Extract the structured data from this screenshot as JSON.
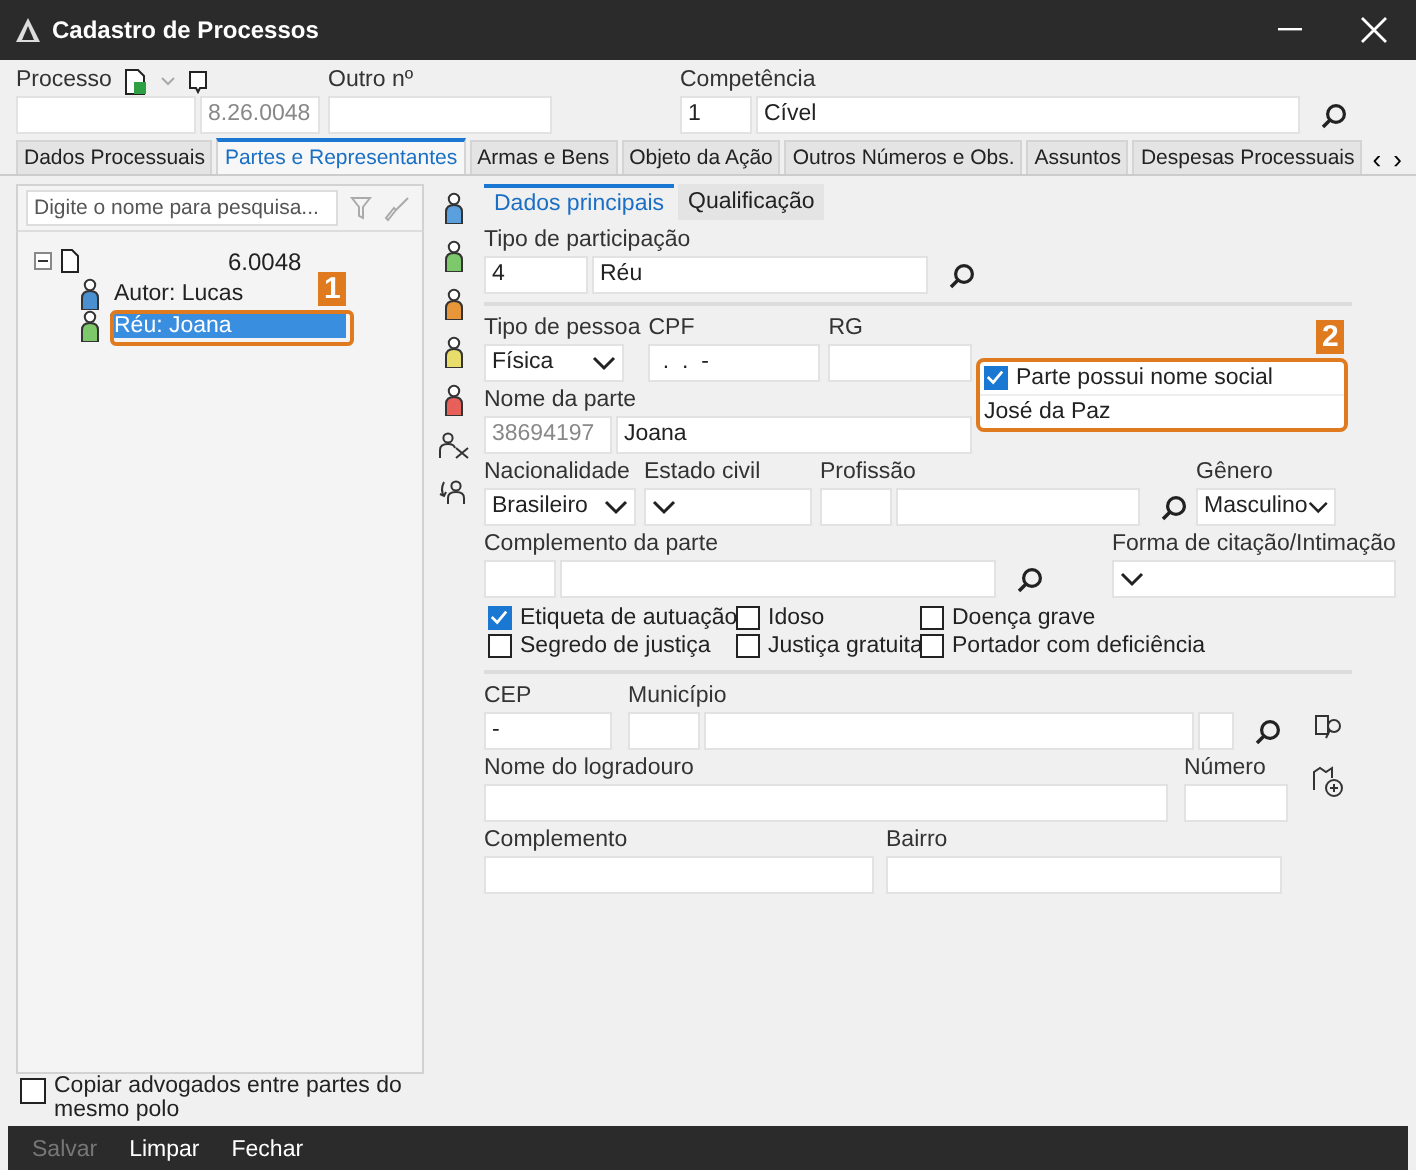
{
  "window": {
    "title": "Cadastro de Processos"
  },
  "header": {
    "processo_label": "Processo",
    "processo_suffix": "8.26.0048",
    "outro_label": "Outro nº",
    "competencia_label": "Competência",
    "competencia_code": "1",
    "competencia_name": "Cível"
  },
  "tabs": [
    {
      "label": "Dados Processuais",
      "selected": false
    },
    {
      "label": "Partes e Representantes",
      "selected": true
    },
    {
      "label": "Armas e Bens",
      "selected": false
    },
    {
      "label": "Objeto da Ação",
      "selected": false
    },
    {
      "label": "Outros Números e Obs.",
      "selected": false
    },
    {
      "label": "Assuntos",
      "selected": false
    },
    {
      "label": "Despesas Processuais",
      "selected": false
    }
  ],
  "tab_scroll": [
    "‹",
    "›"
  ],
  "search": {
    "placeholder": "Digite o nome para pesquisa..."
  },
  "tree": {
    "label": "6.0048",
    "expanded": true,
    "children": [
      {
        "label": "Autor: Lucas",
        "selected": false,
        "color": "#4a8fd0"
      },
      {
        "label": "Réu: Joana",
        "selected": true,
        "color": "#7cc86a"
      }
    ]
  },
  "callouts": [
    "1",
    "2"
  ],
  "party_tools": [
    {
      "color": "#5aa0de"
    },
    {
      "color": "#7cc86a"
    },
    {
      "color": "#e8963a"
    },
    {
      "color": "#e8dc6a"
    },
    {
      "color": "#e8605a"
    }
  ],
  "subtabs": [
    {
      "label": "Dados principais",
      "selected": true
    },
    {
      "label": "Qualificação",
      "selected": false
    }
  ],
  "form_rows": [
    [
      {
        "label": "Tipo de participação",
        "search": true,
        "inputs": [
          {
            "kind": "text",
            "value": "4"
          },
          {
            "kind": "text",
            "value": "Réu"
          }
        ]
      }
    ],
    [
      {
        "label": "Tipo de pessoa",
        "search": false,
        "inputs": [
          {
            "kind": "select",
            "value": "Física"
          }
        ]
      },
      {
        "label": "CPF",
        "search": false,
        "inputs": [
          {
            "kind": "text",
            "value": " .  .  -"
          }
        ]
      },
      {
        "label": "RG",
        "search": false,
        "inputs": [
          {
            "kind": "text"
          }
        ]
      }
    ],
    [
      {
        "label": "Nome da parte",
        "search": false,
        "inputs": [
          {
            "kind": "readonly",
            "value": "38694197"
          },
          {
            "kind": "text",
            "value": "Joana"
          }
        ]
      }
    ],
    [
      {
        "label": "Nacionalidade",
        "search": false,
        "inputs": [
          {
            "kind": "select",
            "value": "Brasileiro"
          }
        ]
      },
      {
        "label": "Estado civil",
        "search": false,
        "inputs": [
          {
            "kind": "select"
          }
        ]
      },
      {
        "label": "Profissão",
        "search": true,
        "inputs": [
          {
            "kind": "text"
          },
          {
            "kind": "text"
          }
        ]
      },
      {
        "label": "Gênero",
        "search": false,
        "inputs": [
          {
            "kind": "select",
            "value": "Masculino"
          }
        ]
      }
    ],
    [
      {
        "label": "Complemento da parte",
        "search": true,
        "inputs": [
          {
            "kind": "text"
          },
          {
            "kind": "text"
          }
        ]
      },
      {
        "label": "Forma de citação/Intimação",
        "search": false,
        "inputs": [
          {
            "kind": "select"
          }
        ]
      }
    ]
  ],
  "social_name": {
    "label": "Parte possui nome social",
    "checked": true,
    "value": "José da Paz"
  },
  "flags": [
    {
      "label": "Etiqueta de autuação",
      "checked": true
    },
    {
      "label": "Idoso",
      "checked": false
    },
    {
      "label": "Doença grave",
      "checked": false
    },
    {
      "label": "Segredo de justiça",
      "checked": false
    },
    {
      "label": "Justiça gratuita",
      "checked": false
    },
    {
      "label": "Portador com deficiência",
      "checked": false
    }
  ],
  "address_rows": [
    [
      {
        "label": "CEP",
        "search": false,
        "inputs": [
          {
            "kind": "text",
            "value": "-"
          }
        ]
      },
      {
        "label": "Município",
        "search": true,
        "inputs": [
          {
            "kind": "text"
          },
          {
            "kind": "text"
          },
          {
            "kind": "text"
          }
        ]
      }
    ],
    [
      {
        "label": "Nome do logradouro",
        "search": false,
        "inputs": [
          {
            "kind": "text"
          }
        ]
      },
      {
        "label": "Número",
        "search": false,
        "inputs": [
          {
            "kind": "text"
          }
        ]
      }
    ],
    [
      {
        "label": "Complemento",
        "search": false,
        "inputs": [
          {
            "kind": "text"
          }
        ]
      },
      {
        "label": "Bairro",
        "search": false,
        "inputs": [
          {
            "kind": "text"
          }
        ]
      }
    ]
  ],
  "copy_lawyers": {
    "label": "Copiar advogados entre partes do mesmo polo",
    "checked": false
  },
  "footer": [
    {
      "label": "Salvar",
      "disabled": true
    },
    {
      "label": "Limpar",
      "disabled": false
    },
    {
      "label": "Fechar",
      "disabled": false
    }
  ]
}
